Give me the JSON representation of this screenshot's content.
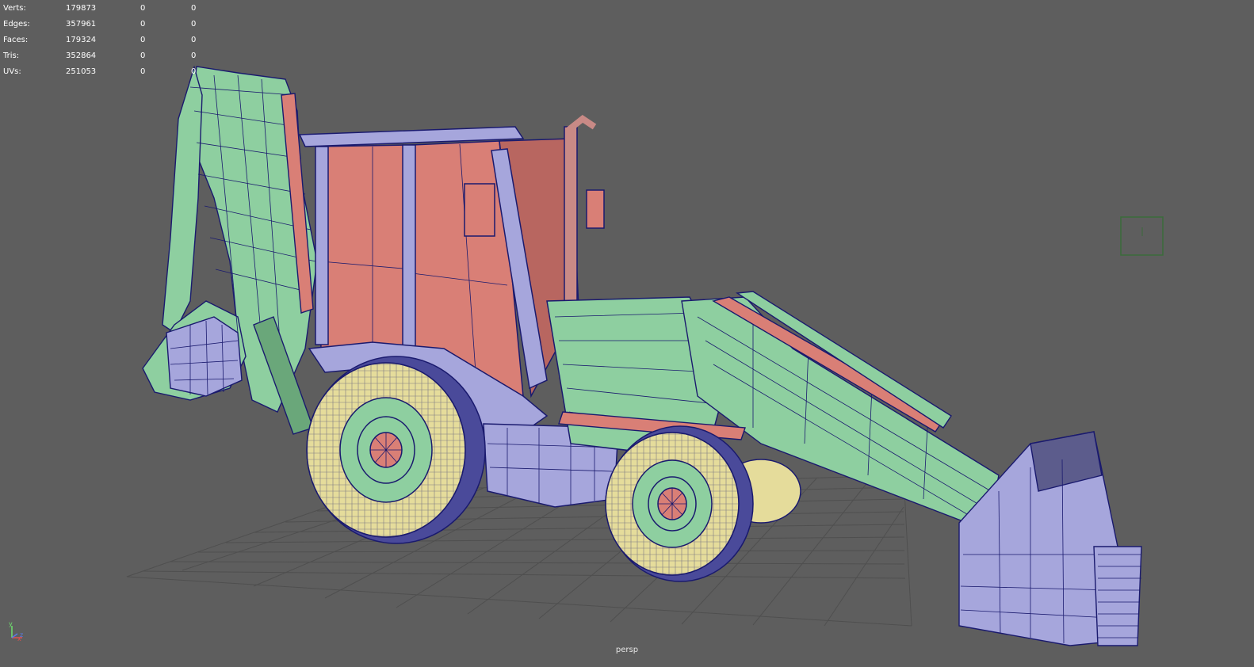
{
  "viewport": {
    "background": "#5e5e5e",
    "camera": "persp"
  },
  "hud": {
    "rows": [
      {
        "label": "Verts:",
        "v1": "179873",
        "v2": "0",
        "v3": "0"
      },
      {
        "label": "Edges:",
        "v1": "357961",
        "v2": "0",
        "v3": "0"
      },
      {
        "label": "Faces:",
        "v1": "179324",
        "v2": "0",
        "v3": "0"
      },
      {
        "label": "Tris:",
        "v1": "352864",
        "v2": "0",
        "v3": "0"
      },
      {
        "label": "UVs:",
        "v1": "251053",
        "v2": "0",
        "v3": "0"
      }
    ]
  },
  "axis": {
    "x": "x",
    "y": "y",
    "z": "z"
  },
  "colors": {
    "wire": "#1a1a6e",
    "body_green": "#8ecfa0",
    "cab_red": "#d97f76",
    "tire_yellow": "#e5dc9b",
    "bucket_lavender": "#a6a6dc",
    "grid": "#4e4e4e"
  },
  "icons": {
    "axis_gizmo": "xyz-axis-gizmo",
    "manipulator": "view-cube-placeholder"
  }
}
